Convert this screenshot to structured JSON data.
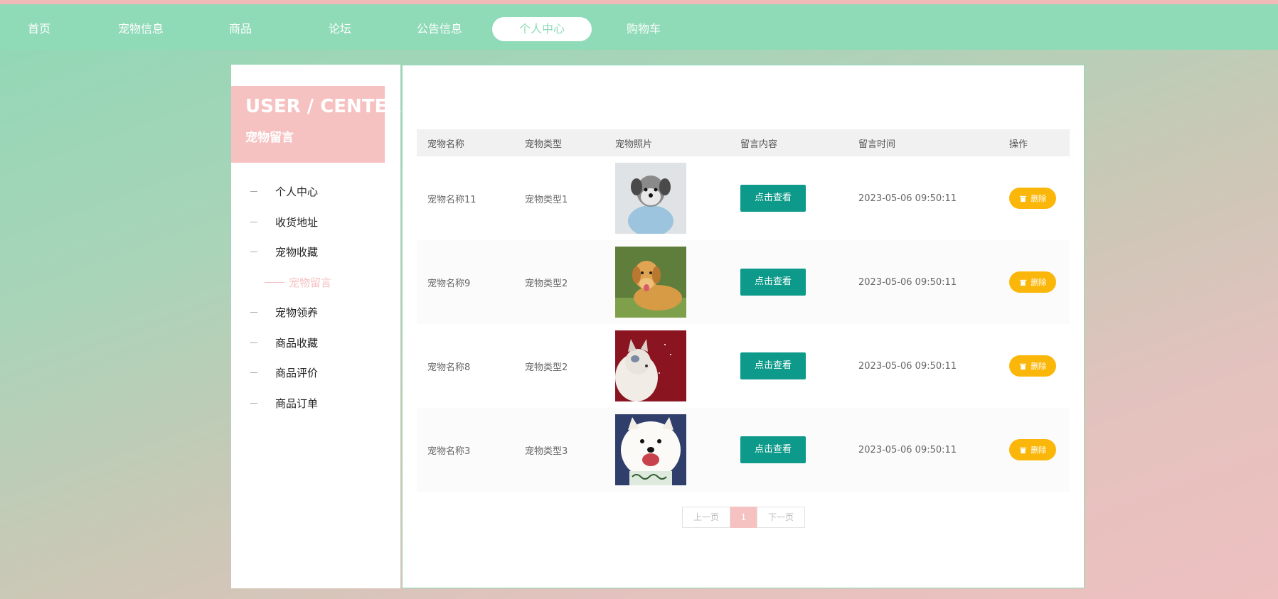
{
  "nav": {
    "items": [
      {
        "label": "首页"
      },
      {
        "label": "宠物信息"
      },
      {
        "label": "商品"
      },
      {
        "label": "论坛"
      },
      {
        "label": "公告信息"
      },
      {
        "label": "个人中心",
        "active": true
      },
      {
        "label": "购物车"
      }
    ]
  },
  "sidebar": {
    "title": "USER / CENTER",
    "subtitle": "宠物留言",
    "items": [
      {
        "label": "个人中心"
      },
      {
        "label": "收货地址"
      },
      {
        "label": "宠物收藏"
      },
      {
        "label": "宠物留言",
        "active": true
      },
      {
        "label": "宠物领养"
      },
      {
        "label": "商品收藏"
      },
      {
        "label": "商品评价"
      },
      {
        "label": "商品订单"
      }
    ]
  },
  "table": {
    "headers": [
      "宠物名称",
      "宠物类型",
      "宠物照片",
      "留言内容",
      "留言时间",
      "操作"
    ],
    "rows": [
      {
        "name": "宠物名称11",
        "type": "宠物类型1",
        "photo": "gray-schnauzer-dog-photo",
        "view_label": "点击查看",
        "time": "2023-05-06 09:50:11",
        "delete_label": "删除"
      },
      {
        "name": "宠物名称9",
        "type": "宠物类型2",
        "photo": "golden-retriever-dog-photo",
        "view_label": "点击查看",
        "time": "2023-05-06 09:50:11",
        "delete_label": "删除"
      },
      {
        "name": "宠物名称8",
        "type": "宠物类型2",
        "photo": "white-cat-red-background-photo",
        "view_label": "点击查看",
        "time": "2023-05-06 09:50:11",
        "delete_label": "删除"
      },
      {
        "name": "宠物名称3",
        "type": "宠物类型3",
        "photo": "samoyed-dog-photo",
        "view_label": "点击查看",
        "time": "2023-05-06 09:50:11",
        "delete_label": "删除"
      }
    ]
  },
  "pagination": {
    "prev": "上一页",
    "current": "1",
    "next": "下一页"
  },
  "colors": {
    "nav_bg": "#8fdab7",
    "accent_pink": "#f6c1c1",
    "view_button": "#0d9a8a",
    "delete_button": "#fbb709"
  }
}
